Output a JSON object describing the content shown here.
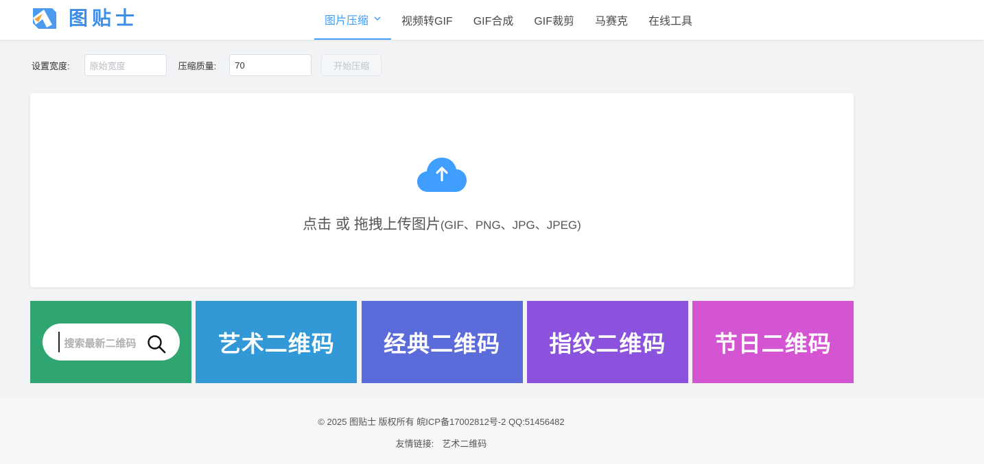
{
  "brand": {
    "name": "图贴士",
    "color": "#3c8ee6"
  },
  "nav": {
    "items": [
      {
        "label": "图片压缩",
        "active": true
      },
      {
        "label": "视频转GIF"
      },
      {
        "label": "GIF合成"
      },
      {
        "label": "GIF裁剪"
      },
      {
        "label": "马赛克"
      },
      {
        "label": "在线工具"
      }
    ]
  },
  "toolbar": {
    "width_label": "设置宽度:",
    "width_placeholder": "原始宽度",
    "quality_label": "压缩质量:",
    "quality_value": "70",
    "start_button": "开始压缩"
  },
  "upload": {
    "icon": "cloud-upload-icon",
    "text_main": "点击 或 拖拽上传图片",
    "text_formats": "(GIF、PNG、JPG、JPEG)",
    "icon_color": "#409eff"
  },
  "tiles": {
    "search_placeholder": "搜索最新二维码",
    "items": [
      {
        "label": "艺术二维码",
        "color": "#3399d6"
      },
      {
        "label": "经典二维码",
        "color": "#5b6bd9"
      },
      {
        "label": "指纹二维码",
        "color": "#8b52de"
      },
      {
        "label": "节日二维码",
        "color": "#d455d2"
      }
    ],
    "search_color": "#2fa672"
  },
  "footer": {
    "copyright": "© 2025 图贴士 版权所有 皖ICP备17002812号-2 QQ:51456482",
    "links_label": "友情链接:",
    "links": [
      "艺术二维码"
    ]
  }
}
